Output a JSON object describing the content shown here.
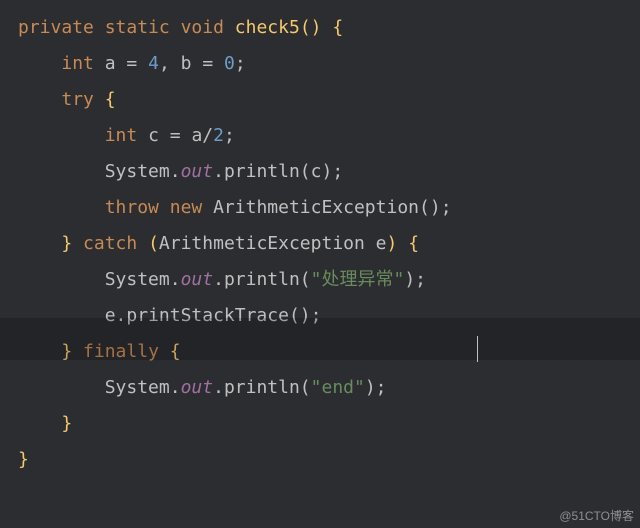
{
  "code": {
    "line1": {
      "kw_private": "private",
      "kw_static": "static",
      "kw_void": "void",
      "fn_name": "check5",
      "paren_open": "(",
      "paren_close": ")",
      "brace_open": "{"
    },
    "line2": {
      "typ_int": "int",
      "var_a": "a",
      "eq1": "=",
      "num4": "4",
      "comma": ",",
      "var_b": "b",
      "eq2": "=",
      "num0": "0",
      "semi": ";"
    },
    "line3": {
      "kw_try": "try",
      "brace_open": "{"
    },
    "line4": {
      "typ_int": "int",
      "var_c": "c",
      "eq": "=",
      "expr_a": "a",
      "slash": "/",
      "num2": "2",
      "semi": ";"
    },
    "line5": {
      "cls_system": "System",
      "dot1": ".",
      "fld_out": "out",
      "dot2": ".",
      "meth": "println",
      "open": "(",
      "arg": "c",
      "close": ")",
      "semi": ";"
    },
    "line6": {
      "kw_throw": "throw",
      "kw_new": "new",
      "cls": "ArithmeticException",
      "open": "(",
      "close": ")",
      "semi": ";"
    },
    "line7": {
      "brace_close": "}",
      "kw_catch": "catch",
      "open": "(",
      "cls": "ArithmeticException",
      "var_e": "e",
      "close": ")",
      "brace_open": "{"
    },
    "line8": {
      "cls_system": "System",
      "dot1": ".",
      "fld_out": "out",
      "dot2": ".",
      "meth": "println",
      "open": "(",
      "str": "\"处理异常\"",
      "close": ")",
      "semi": ";"
    },
    "line9": {
      "var_e": "e",
      "dot": ".",
      "meth": "printStackTrace",
      "open": "(",
      "close": ")",
      "semi": ";"
    },
    "line10": {
      "brace_close": "}",
      "kw_finally": "finally",
      "brace_open": "{"
    },
    "line11": {
      "cls_system": "System",
      "dot1": ".",
      "fld_out": "out",
      "dot2": ".",
      "meth": "println",
      "open": "(",
      "str": "\"end\"",
      "close": ")",
      "semi": ";"
    },
    "line12": {
      "brace_close": "}"
    },
    "line13": {
      "brace_close": "}"
    }
  },
  "watermark": "@51CTO博客"
}
